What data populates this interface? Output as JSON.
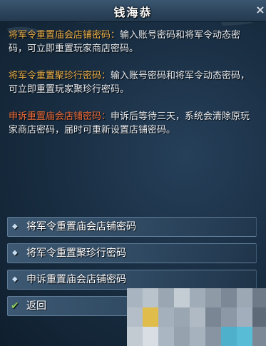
{
  "dialog": {
    "title": "钱海恭",
    "close_glyph": "×"
  },
  "content": {
    "paragraphs": [
      {
        "key": "将军令重置庙会店铺密码：",
        "text": "输入账号密码和将军令动态密码，可立即重置玩家商店密码。"
      },
      {
        "key": "将军令重置聚珍行密码：",
        "text": "输入账号密码和将军令动态密码，可立即重置玩家聚珍行密码。"
      },
      {
        "key": "申诉重置庙会店铺密码：",
        "text": "申诉后等待三天，系统会清除原玩家商店密码，届时可重新设置店铺密码。"
      }
    ]
  },
  "options": [
    {
      "label": "将军令重置庙会店铺密码",
      "icon": "diamond-bullet-icon"
    },
    {
      "label": "将军令重置聚珍行密码",
      "icon": "diamond-bullet-icon"
    },
    {
      "label": "申诉重置庙会店铺密码",
      "icon": "diamond-bullet-icon"
    }
  ],
  "back": {
    "label": "返回",
    "icon": "checkmark-icon"
  },
  "colors": {
    "key_orange": "#f0b24a",
    "key_red": "#ec6b3a",
    "body_text": "#e9edf2",
    "panel_bg": "#1a2f44"
  }
}
